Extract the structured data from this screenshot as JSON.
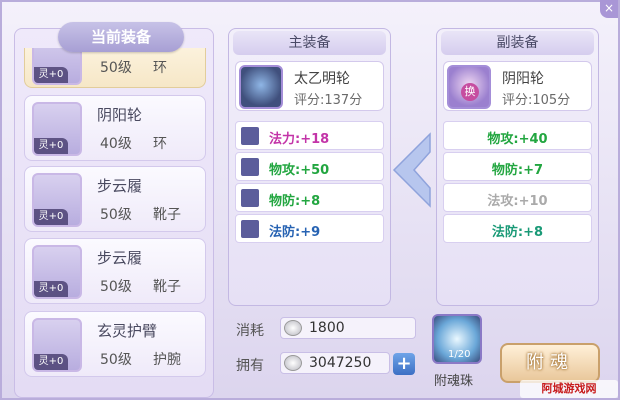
{
  "left_list": {
    "header": "当前装备",
    "items": [
      {
        "spirit": "灵+0",
        "name": "",
        "level": "50级",
        "type": "环"
      },
      {
        "spirit": "灵+0",
        "name": "阴阳轮",
        "level": "40级",
        "type": "环"
      },
      {
        "spirit": "灵+0",
        "name": "步云履",
        "level": "50级",
        "type": "靴子"
      },
      {
        "spirit": "灵+0",
        "name": "步云履",
        "level": "50级",
        "type": "靴子"
      },
      {
        "spirit": "灵+0",
        "name": "玄灵护臂",
        "level": "50级",
        "type": "护腕"
      }
    ]
  },
  "main_equip": {
    "title": "主装备",
    "name": "太乙明轮",
    "score": "评分:137分",
    "stats": [
      {
        "label": "法力:+18",
        "color": "magenta"
      },
      {
        "label": "物攻:+50",
        "color": "green"
      },
      {
        "label": "物防:+8",
        "color": "green"
      },
      {
        "label": "法防:+9",
        "color": "blue"
      }
    ]
  },
  "sub_equip": {
    "title": "副装备",
    "name": "阴阳轮",
    "score": "评分:105分",
    "icon_badge": "换",
    "stats": [
      {
        "label": "物攻:+40",
        "color": "green"
      },
      {
        "label": "物防:+7",
        "color": "green"
      },
      {
        "label": "法攻:+10",
        "color": "gray"
      },
      {
        "label": "法防:+8",
        "color": "teal"
      }
    ]
  },
  "bottom": {
    "cost_label": "消耗",
    "cost_value": "1800",
    "own_label": "拥有",
    "own_value": "3047250",
    "plus_symbol": "+",
    "item_count": "1/20",
    "item_label": "附魂珠",
    "attach_button": "附魂"
  },
  "watermark": "阿城游戏网"
}
